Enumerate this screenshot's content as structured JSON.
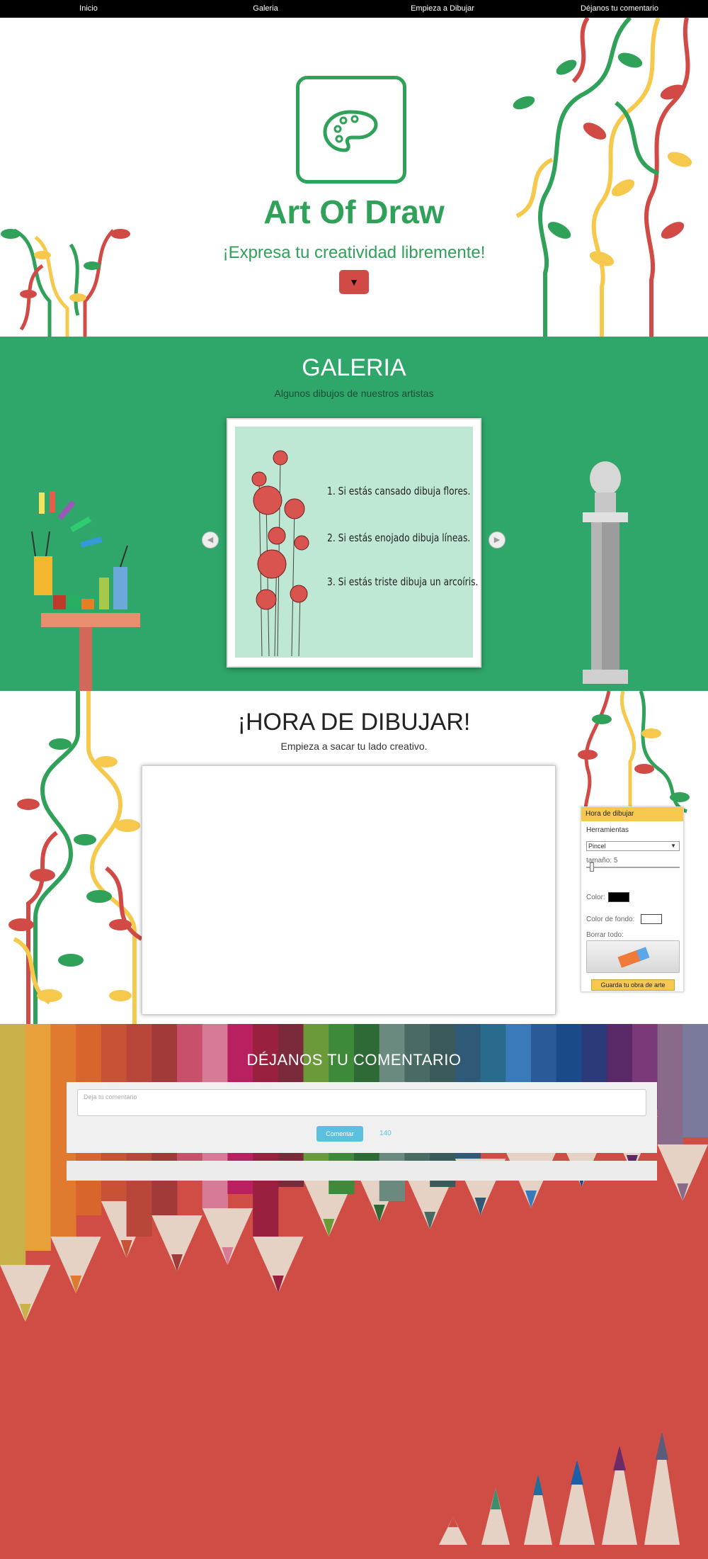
{
  "nav": {
    "items": [
      "Inicio",
      "Galeria",
      "Empieza a Dibujar",
      "Déjanos tu comentario"
    ]
  },
  "hero": {
    "title": "Art Of Draw",
    "subtitle": "¡Expresa tu creatividad libremente!",
    "down_icon": "chevron-down-icon",
    "accent": "#2fa158"
  },
  "galeria": {
    "title": "GALERIA",
    "subtitle": "Algunos dibujos de nuestros artistas",
    "quotes": [
      "1. Si estás cansado dibuja flores.",
      "2. Si estás enojado dibuja líneas.",
      "3. Si estás triste dibuja un arcoíris."
    ],
    "bg": "#2fa76a"
  },
  "dibujar": {
    "title": "¡HORA DE DIBUJAR!",
    "subtitle": "Empieza a sacar tu lado creativo.",
    "panel": {
      "title": "Hora de dibujar",
      "tools_label": "Herramientas",
      "tool_selected": "Pincel",
      "size_label": "tamaño: 5",
      "color_label": "Color:",
      "color_value": "#000000",
      "bg_label": "Color de fondo:",
      "bg_value": "#ffffff",
      "clear_label": "Borrar todo:",
      "save_label": "Guarda tu obra de arte"
    }
  },
  "comentario": {
    "title": "DÉJANOS TU COMENTARIO",
    "placeholder": "Deja tu comentario",
    "button": "Comentar",
    "count": "140",
    "bg": "#d04d45"
  }
}
